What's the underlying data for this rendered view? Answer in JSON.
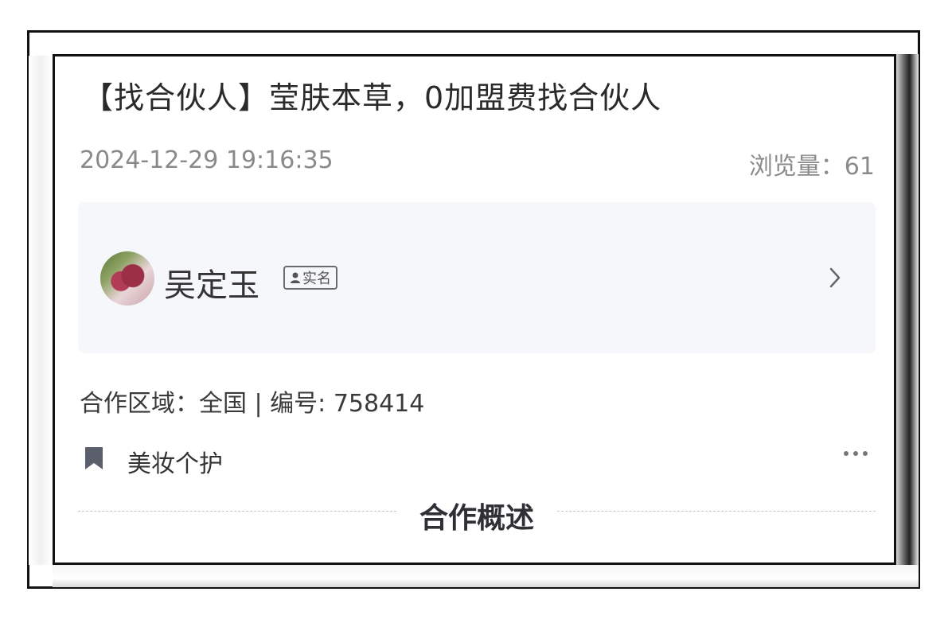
{
  "post": {
    "title": "【找合伙人】莹肤本草，0加盟费找合伙人",
    "date": "2024-12-29 19:16:35",
    "views_label": "浏览量：61"
  },
  "author": {
    "name": "吴定玉",
    "badge": "实名"
  },
  "details": {
    "region_line": "合作区域：全国 | 编号: 758414",
    "category": "美妆个护"
  },
  "section": {
    "title": "合作概述"
  },
  "icons": {
    "avatar": "avatar-image",
    "badge": "person-icon",
    "chevron": "chevron-right-icon",
    "category": "bookmark-icon",
    "more": "more-dots-icon"
  },
  "colors": {
    "card_bg": "#f6f7fa",
    "muted_text": "#8a8a8a",
    "section_title": "#2f3036"
  }
}
